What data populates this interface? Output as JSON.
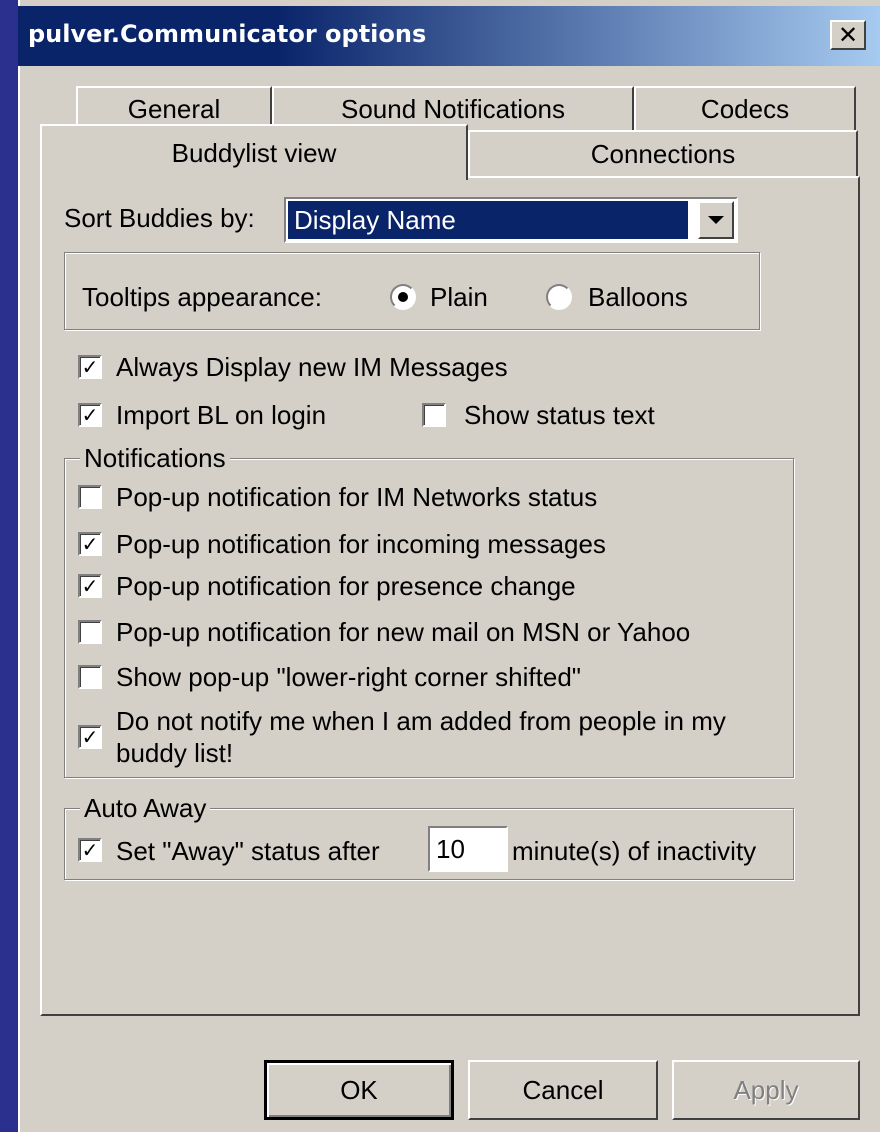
{
  "window": {
    "title": "pulver.Communicator options",
    "close_symbol": "✕"
  },
  "tabs": {
    "row1": [
      "General",
      "Sound Notifications",
      "Codecs"
    ],
    "row2": [
      "Buddylist view",
      "Connections"
    ],
    "active": "Buddylist view"
  },
  "sort": {
    "label": "Sort Buddies by:",
    "value": "Display Name"
  },
  "tooltips": {
    "label": "Tooltips appearance:",
    "options": [
      "Plain",
      "Balloons"
    ],
    "selected": "Plain"
  },
  "options": {
    "always_display": {
      "label": "Always Display new IM Messages",
      "checked": true
    },
    "import_bl": {
      "label": "Import BL on login",
      "checked": true
    },
    "show_status": {
      "label": "Show status text",
      "checked": false
    }
  },
  "notifications": {
    "title": "Notifications",
    "items": [
      {
        "label": "Pop-up notification for IM Networks status",
        "checked": false
      },
      {
        "label": "Pop-up notification for incoming messages",
        "checked": true
      },
      {
        "label": "Pop-up notification for presence change",
        "checked": true
      },
      {
        "label": "Pop-up notification for new mail on MSN or Yahoo",
        "checked": false
      },
      {
        "label": "Show pop-up \"lower-right corner shifted\"",
        "checked": false
      },
      {
        "label": "Do not notify me when I am added from people in my",
        "label2": "buddy list!",
        "checked": true
      }
    ]
  },
  "auto_away": {
    "title": "Auto Away",
    "label_before": "Set \"Away\" status after",
    "minutes": "10",
    "label_after": "minute(s) of inactivity",
    "checked": true
  },
  "buttons": {
    "ok": "OK",
    "cancel": "Cancel",
    "apply": "Apply"
  },
  "check_mark": "✓"
}
